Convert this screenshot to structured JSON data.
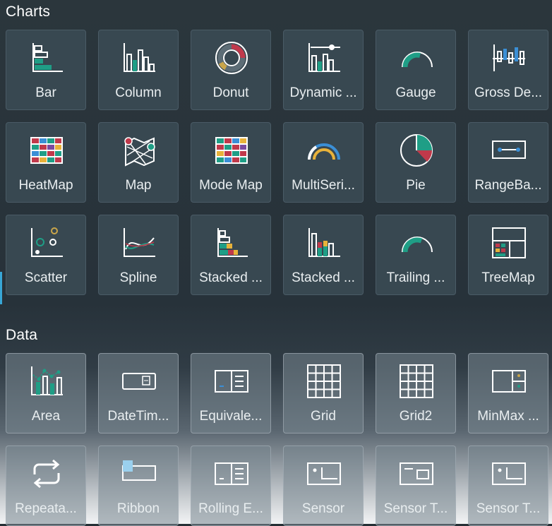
{
  "sections": [
    {
      "title": "Charts",
      "items": [
        {
          "label": "Bar",
          "icon": "bar-chart-icon"
        },
        {
          "label": "Column",
          "icon": "column-chart-icon"
        },
        {
          "label": "Donut",
          "icon": "donut-chart-icon"
        },
        {
          "label": "Dynamic ...",
          "icon": "dynamic-chart-icon"
        },
        {
          "label": "Gauge",
          "icon": "gauge-icon"
        },
        {
          "label": "Gross De...",
          "icon": "gross-deviation-icon"
        },
        {
          "label": "HeatMap",
          "icon": "heatmap-icon"
        },
        {
          "label": "Map",
          "icon": "map-icon"
        },
        {
          "label": "Mode Map",
          "icon": "mode-map-icon"
        },
        {
          "label": "MultiSeri...",
          "icon": "multiseries-gauge-icon"
        },
        {
          "label": "Pie",
          "icon": "pie-chart-icon"
        },
        {
          "label": "RangeBa...",
          "icon": "range-bar-icon"
        },
        {
          "label": "Scatter",
          "icon": "scatter-chart-icon"
        },
        {
          "label": "Spline",
          "icon": "spline-chart-icon"
        },
        {
          "label": "Stacked ...",
          "icon": "stacked-bar-icon"
        },
        {
          "label": "Stacked ...",
          "icon": "stacked-column-icon"
        },
        {
          "label": "Trailing ...",
          "icon": "trailing-gauge-icon"
        },
        {
          "label": "TreeMap",
          "icon": "treemap-icon"
        }
      ]
    },
    {
      "title": "Data",
      "items": [
        {
          "label": "Area",
          "icon": "area-chart-icon"
        },
        {
          "label": "DateTim...",
          "icon": "datetime-icon"
        },
        {
          "label": "Equivale...",
          "icon": "equivalent-icon"
        },
        {
          "label": "Grid",
          "icon": "grid-icon"
        },
        {
          "label": "Grid2",
          "icon": "grid2-icon"
        },
        {
          "label": "MinMax ...",
          "icon": "minmax-icon"
        },
        {
          "label": "Repeata...",
          "icon": "repeat-icon"
        },
        {
          "label": "Ribbon",
          "icon": "ribbon-icon"
        },
        {
          "label": "Rolling E...",
          "icon": "rolling-icon"
        },
        {
          "label": "Sensor",
          "icon": "sensor-icon"
        },
        {
          "label": "Sensor T...",
          "icon": "sensor-table-icon"
        },
        {
          "label": "Sensor T...",
          "icon": "sensor-tile-icon"
        }
      ]
    }
  ],
  "colors": {
    "teal": "#1f9e86",
    "red": "#c0394b",
    "yellow": "#e8b23a",
    "blue": "#3b8fd6",
    "purple": "#7b4aa0",
    "gold": "#c9a54a"
  }
}
